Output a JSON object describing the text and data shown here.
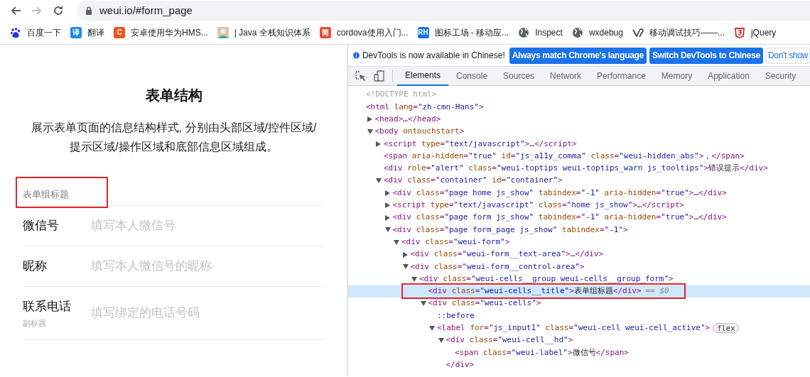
{
  "browser": {
    "back_enabled": true,
    "forward_enabled": false,
    "url": "weui.io/#form_page"
  },
  "bookmarks": [
    {
      "label": "百度一下",
      "color": "#2932e1"
    },
    {
      "label": "翻译",
      "glyph": "译",
      "color": "#1e88e5"
    },
    {
      "label": "安卓使用华为HMS...",
      "glyph": "C",
      "color": "#f4511e"
    },
    {
      "label": "| Java 全栈知识体系",
      "color": "#d8c8a8"
    },
    {
      "label": "cordova使用入门...",
      "glyph": "简",
      "color": "#e0533b"
    },
    {
      "label": "图标工场 - 移动应...",
      "glyph": "RH",
      "color": "#1a73e8"
    },
    {
      "label": "Inspect",
      "color": "#5f6368"
    },
    {
      "label": "wxdebug",
      "color": "#5f6368"
    },
    {
      "label": "移动调试技巧——...",
      "color": "#333333"
    },
    {
      "label": "jQuery",
      "color": "#d32f2f"
    }
  ],
  "page": {
    "title": "表单结构",
    "description": "展示表单页面的信息结构样式, 分别由头部区域/控件区域/提示区域/操作区域和底部信息区域组成。",
    "group_title": "表单组标题",
    "fields": [
      {
        "label": "微信号",
        "placeholder": "填写本人微信号"
      },
      {
        "label": "昵称",
        "placeholder": "填写本人微信号的昵称"
      },
      {
        "label": "联系电话",
        "sublabel": "副标题",
        "placeholder": "填写绑定的电话号码"
      }
    ]
  },
  "devtools": {
    "infobar": {
      "message": "DevTools is now available in Chinese!",
      "buttons": [
        {
          "label": "Always match Chrome's language",
          "kind": "primary"
        },
        {
          "label": "Switch DevTools to Chinese",
          "kind": "primary"
        },
        {
          "label": "Don't show",
          "kind": "secondary"
        }
      ]
    },
    "tabs": [
      {
        "label": "Elements",
        "selected": true
      },
      {
        "label": "Console",
        "selected": false
      },
      {
        "label": "Sources",
        "selected": false
      },
      {
        "label": "Network",
        "selected": false
      },
      {
        "label": "Performance",
        "selected": false
      },
      {
        "label": "Memory",
        "selected": false
      },
      {
        "label": "Application",
        "selected": false
      },
      {
        "label": "Security",
        "selected": false
      }
    ],
    "tree": [
      {
        "kind": "doctype",
        "text": "<!DOCTYPE html>"
      },
      {
        "text": "<html lang=\"zh-cmn-Hans\">",
        "children": [
          {
            "text": "<head>…</head>",
            "expanded": false
          },
          {
            "text": "<body ontouchstart>",
            "expanded": true,
            "children": [
              {
                "text": "<script type=\"text/javascript\">…</script>",
                "expanded": false
              },
              {
                "text": "<span aria-hidden=\"true\" id=\"js_a11y_comma\" class=\"weui-hidden_abs\">，</span>"
              },
              {
                "text": "<div role=\"alert\" class=\"weui-toptips weui-toptips_warn js_tooltips\">错误提示</div>"
              },
              {
                "text": "<div class=\"container\" id=\"container\">",
                "expanded": true,
                "children": [
                  {
                    "text": "<div class=\"page home js_show\" tabindex=\"-1\" aria-hidden=\"true\">…</div>",
                    "expanded": false
                  },
                  {
                    "text": "<script type=\"text/javascript\" class=\"home js_show\">…</script>",
                    "expanded": false
                  },
                  {
                    "text": "<div class=\"page form js_show\" tabindex=\"-1\" aria-hidden=\"true\">…</div>",
                    "expanded": false
                  },
                  {
                    "text": "<div class=\"page form_page js_show\" tabindex=\"-1\">",
                    "expanded": true,
                    "children": [
                      {
                        "text": "<div class=\"weui-form\">",
                        "expanded": true,
                        "children": [
                          {
                            "text": "<div class=\"weui-form__text-area\">…</div>",
                            "expanded": false
                          },
                          {
                            "text": "<div class=\"weui-form__control-area\">",
                            "expanded": true,
                            "children": [
                              {
                                "text": "<div class=\"weui-cells__group weui-cells__group_form\">",
                                "expanded": true,
                                "children": [
                                  {
                                    "text": "<div class=\"weui-cells__title\">表单组标题</div>",
                                    "selected": true,
                                    "suffix": "== $0"
                                  },
                                  {
                                    "text": "<div class=\"weui-cells\">",
                                    "expanded": true,
                                    "children": [
                                      {
                                        "kind": "pseudo",
                                        "text": "::before"
                                      },
                                      {
                                        "text": "<label for=\"js_input1\" class=\"weui-cell weui-cell_active\">",
                                        "expanded": true,
                                        "badge": "flex",
                                        "children": [
                                          {
                                            "text": "<div class=\"weui-cell__hd\">",
                                            "expanded": true,
                                            "children": [
                                              {
                                                "text": "<span class=\"weui-label\">微信号</span>"
                                              }
                                            ]
                                          },
                                          {
                                            "text": "</div>"
                                          }
                                        ]
                                      }
                                    ]
                                  }
                                ]
                              }
                            ]
                          }
                        ]
                      }
                    ]
                  }
                ]
              }
            ]
          }
        ]
      }
    ]
  }
}
